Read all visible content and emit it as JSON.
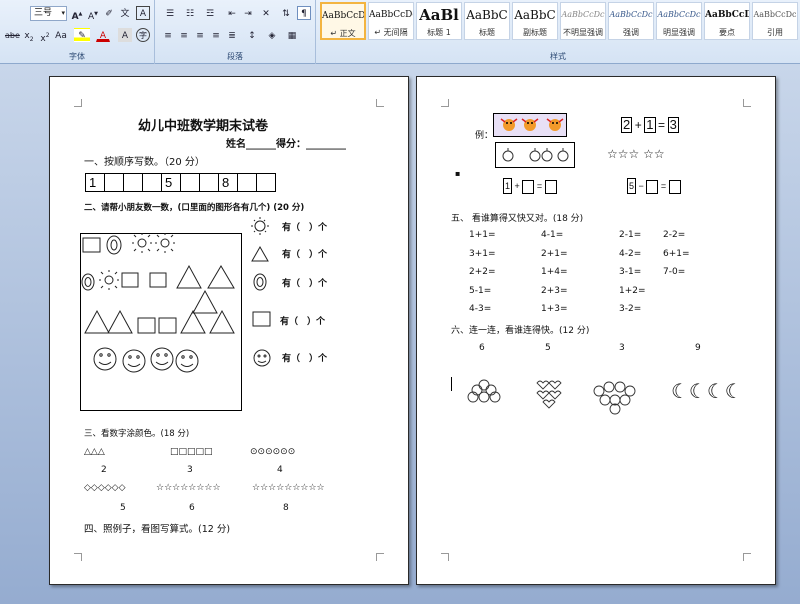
{
  "ribbon": {
    "font_size": "三号",
    "font_group_label": "字体",
    "paragraph_group_label": "段落",
    "styles_group_label": "样式",
    "styles": [
      {
        "sample": "AaBbCcDc",
        "name": "↵ 正文",
        "selected": true
      },
      {
        "sample": "AaBbCcDc",
        "name": "↵ 无间隔"
      },
      {
        "sample": "AaBl",
        "name": "标题 1"
      },
      {
        "sample": "AaBbC",
        "name": "标题"
      },
      {
        "sample": "AaBbC",
        "name": "副标题"
      },
      {
        "sample": "AaBbCcDc",
        "name": "不明显强调"
      },
      {
        "sample": "AaBbCcDc",
        "name": "强调"
      },
      {
        "sample": "AaBbCcDc",
        "name": "明显强调"
      },
      {
        "sample": "AaBbCcD",
        "name": "要点"
      },
      {
        "sample": "AaBbCcDc",
        "name": "引用"
      }
    ]
  },
  "page1": {
    "title": "幼儿中班数学期末试卷",
    "name_score": "姓名______得分：________",
    "q1": "一、按顺序写数。（20 分）",
    "q1_cells": [
      "1",
      "",
      "",
      "",
      "5",
      "",
      "",
      "8",
      "",
      ""
    ],
    "q2": "二、请帮小朋友数一数，(口里面的图形各有几个) (20 分)",
    "q2_answers": [
      "有（　）个",
      "有（　）个",
      "有（　）个",
      "有（　）个",
      "有（　）个"
    ],
    "q3": "三、看数字涂颜色。(18 分)",
    "q3_rows": [
      {
        "glyphs": [
          "△△△",
          "□□□□□",
          "⊙⊙⊙⊙⊙⊙"
        ],
        "nums": [
          "2",
          "3",
          "4"
        ]
      },
      {
        "glyphs": [
          "◇◇◇◇◇◇",
          "☆☆☆☆☆☆☆☆",
          "☆☆☆☆☆☆☆☆☆"
        ],
        "nums": [
          "5",
          "6",
          "8"
        ]
      }
    ],
    "q4": "四、照例子，看图写算式。(12 分)"
  },
  "page2": {
    "example_label": "例：",
    "example_eq": {
      "a": "2",
      "op": "+",
      "b": "1",
      "eq": "=",
      "c": "3"
    },
    "stars": "☆☆☆ ☆☆",
    "eq2_left": {
      "a": "1",
      "op": "+",
      "eq": "="
    },
    "eq2_right": {
      "a": "5",
      "op": "−",
      "eq": "="
    },
    "q5": "五、 看谁算得又快又对。(18 分)",
    "q5_cols": [
      [
        "1+1=",
        "3+1=",
        "2+2=",
        "5-1=",
        "4-3="
      ],
      [
        "4-1=",
        "2+1=",
        "1+4=",
        "2+3=",
        "1+3="
      ],
      [
        "2-1=",
        "4-2=",
        "3-1=",
        "1+2=",
        "3-2="
      ],
      [
        "2-2=",
        "6+1=",
        "7-0="
      ]
    ],
    "q6": "六、连一连，看谁连得快。(12 分)",
    "q6_numbers": [
      "6",
      "5",
      "3",
      "9"
    ],
    "q6_moons": "☾☾☾☾"
  }
}
